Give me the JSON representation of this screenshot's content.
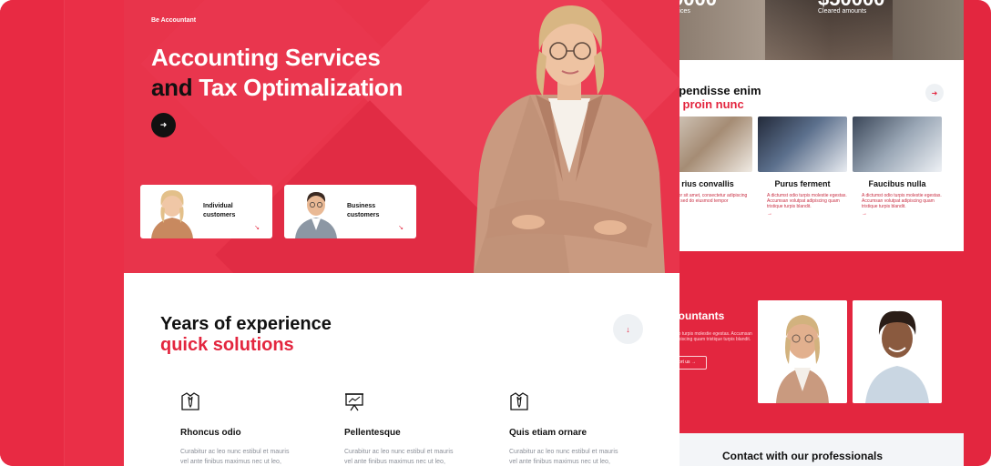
{
  "hero": {
    "brand": "Be Accountant",
    "headline_line1": "Accounting Services",
    "headline_and": "and",
    "headline_line2_rest": " Tax Optimalization",
    "arrow_icon": "arrow-right-icon"
  },
  "customers": [
    {
      "line1": "Individual",
      "line2": "customers"
    },
    {
      "line1": "Business",
      "line2": "customers"
    }
  ],
  "experience": {
    "title": "Years of experience",
    "subtitle": "quick solutions"
  },
  "features": [
    {
      "title": "Rhoncus odio",
      "desc": "Curabitur ac leo nunc estibul et mauris vel ante finibus maximus nec ut leo,",
      "icon": "shirt-tie-icon"
    },
    {
      "title": "Pellentesque",
      "desc": "Curabitur ac leo nunc estibul et mauris vel ante finibus maximus nec ut leo,",
      "icon": "presentation-chart-icon"
    },
    {
      "title": "Quis etiam ornare",
      "desc": "Curabitur ac leo nunc estibul et mauris vel ante finibus maximus nec ut leo,",
      "icon": "shirt-tie-icon"
    }
  ],
  "back": {
    "stat1_num": "9000",
    "stat1_label": "voices",
    "stat2_num": "$50000",
    "stat2_label": "Cleared amounts",
    "section_title": "spendisse enim",
    "section_title_red": "d proin nunc",
    "services": [
      {
        "title": "rius convallis",
        "desc": "dolor sit amet, consectetur adipiscing elit, sed do eiusmod tempor"
      },
      {
        "title": "Purus ferment",
        "desc": "A dictumst odio turpis molestie egestas. Accumsan volutpat adipiscing quam tristique turpis blandit."
      },
      {
        "title": "Faucibus nulla",
        "desc": "A dictumst odio turpis molestie egestas. Accumsan volutpat adipiscing quam tristique turpis blandit."
      }
    ],
    "accountants_title": "countants",
    "accountants_desc": "odio turpis molestie egestas. Accumsan adipiscing quam tristique turpis blandit.",
    "accountants_button": "ort us",
    "contact_title": "Contact with our professionals"
  },
  "colors": {
    "accent": "#e3263f",
    "dark": "#111111"
  }
}
